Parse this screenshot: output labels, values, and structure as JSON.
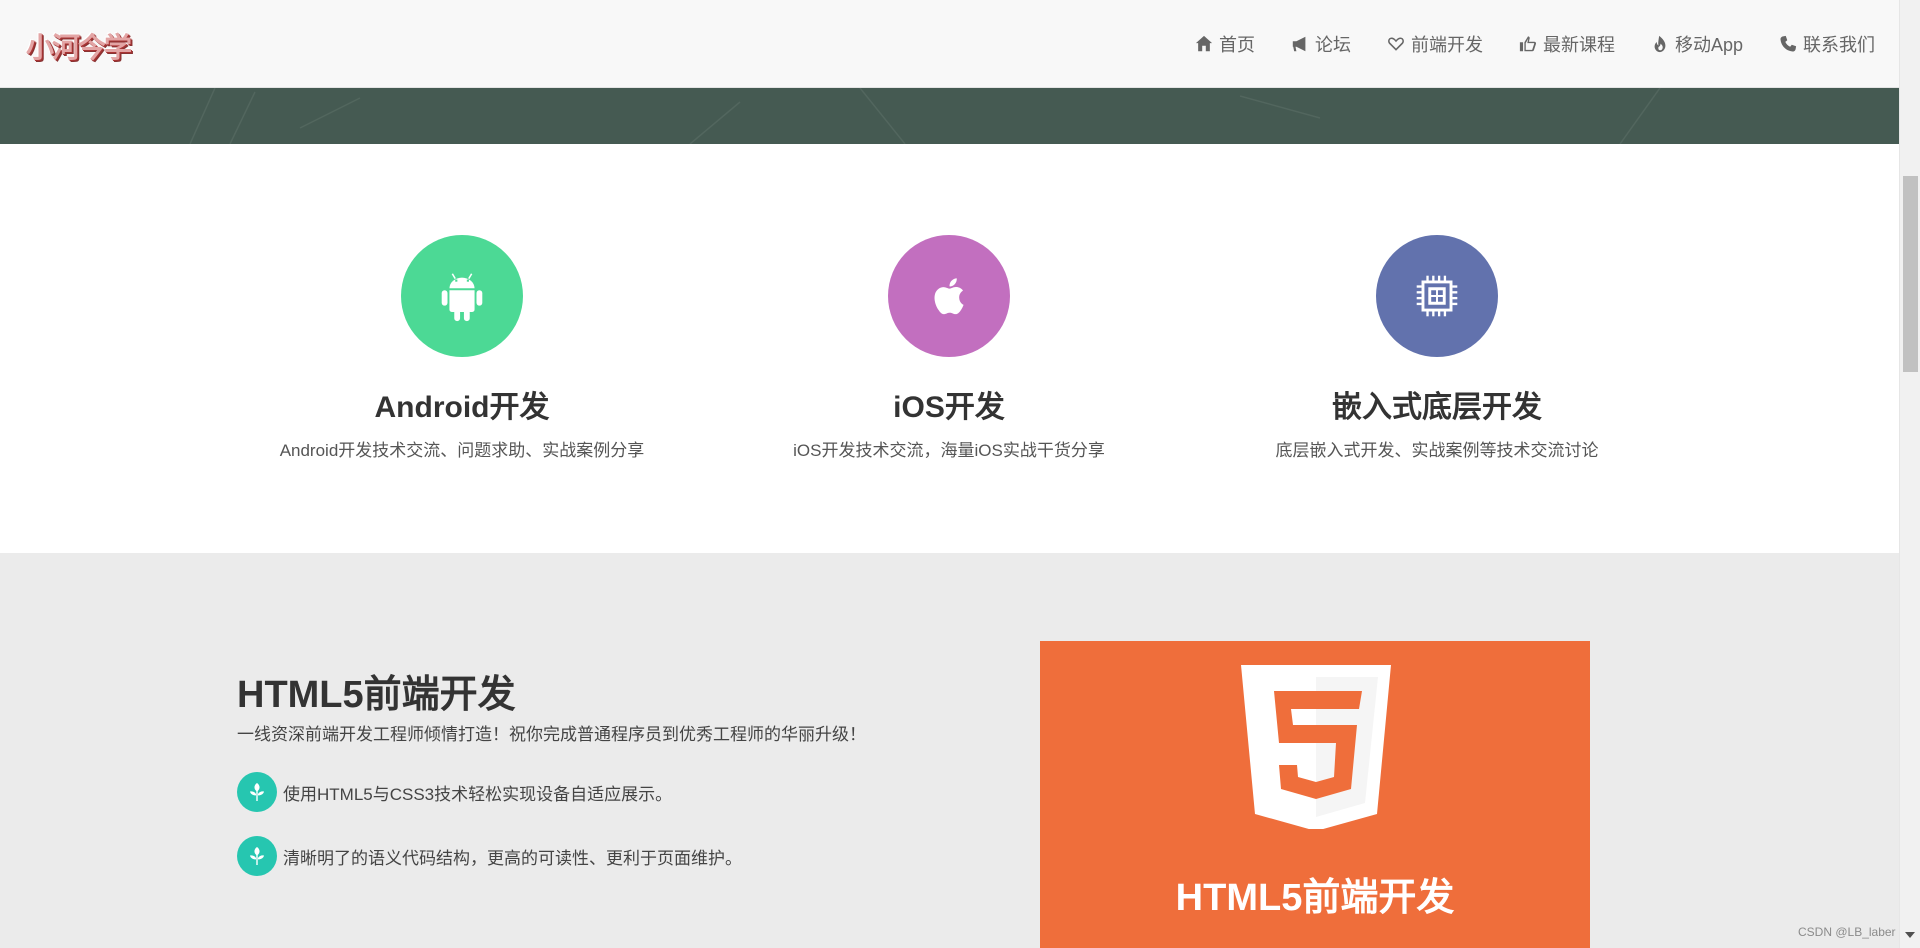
{
  "header": {
    "logo_text": "小河今学",
    "nav": [
      {
        "label": "首页",
        "icon": "home-icon"
      },
      {
        "label": "论坛",
        "icon": "megaphone-icon"
      },
      {
        "label": "前端开发",
        "icon": "heart-icon"
      },
      {
        "label": "最新课程",
        "icon": "thumbs-up-icon"
      },
      {
        "label": "移动App",
        "icon": "fire-icon"
      },
      {
        "label": "联系我们",
        "icon": "phone-icon"
      }
    ]
  },
  "services": [
    {
      "title": "Android开发",
      "desc": "Android开发技术交流、问题求助、实战案例分享",
      "icon": "android-icon",
      "color": "#4cd995"
    },
    {
      "title": "iOS开发",
      "desc": "iOS开发技术交流，海量iOS实战干货分享",
      "icon": "apple-icon",
      "color": "#c26fbf"
    },
    {
      "title": "嵌入式底层开发",
      "desc": "底层嵌入式开发、实战案例等技术交流讨论",
      "icon": "chip-icon",
      "color": "#6272ad"
    }
  ],
  "html5_section": {
    "title": "HTML5前端开发",
    "subtitle": "一线资深前端开发工程师倾情打造！祝你完成普通程序员到优秀工程师的华丽升级！",
    "features": [
      {
        "text": "使用HTML5与CSS3技术轻松实现设备自适应展示。",
        "icon": "leaf-icon"
      },
      {
        "text": "清晰明了的语义代码结构，更高的可读性、更利于页面维护。",
        "icon": "leaf-icon"
      }
    ],
    "image_caption": "HTML5前端开发",
    "image_color": "#ef6e3b"
  },
  "watermark": "CSDN @LB_laber"
}
